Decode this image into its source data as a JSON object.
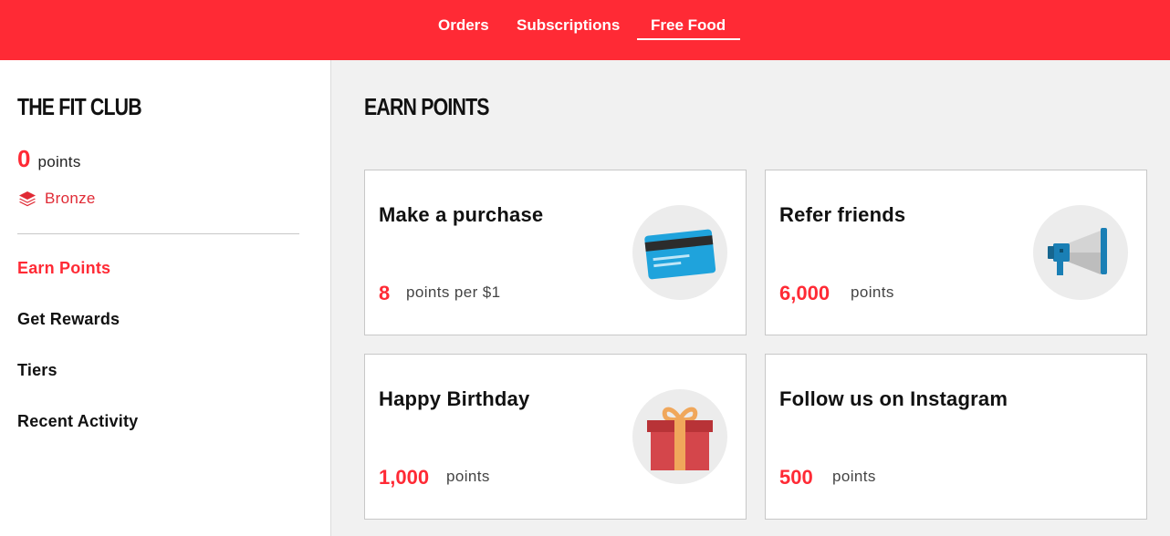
{
  "topnav": {
    "tabs": [
      {
        "label": "Orders"
      },
      {
        "label": "Subscriptions"
      },
      {
        "label": "Free Food",
        "active": true
      }
    ]
  },
  "sidebar": {
    "title": "THE FIT CLUB",
    "points_value": "0",
    "points_label": "points",
    "tier": "Bronze",
    "tier_icon": "layers-icon",
    "items": [
      {
        "label": "Earn Points",
        "active": true
      },
      {
        "label": "Get Rewards"
      },
      {
        "label": "Tiers"
      },
      {
        "label": "Recent Activity"
      }
    ]
  },
  "main": {
    "title": "EARN POINTS",
    "cards": [
      {
        "title": "Make a purchase",
        "value": "8",
        "unit": "points per $1",
        "icon": "credit-card-icon"
      },
      {
        "title": "Refer friends",
        "value": "6,000",
        "unit": "points",
        "icon": "megaphone-icon"
      },
      {
        "title": "Happy Birthday",
        "value": "1,000",
        "unit": "points",
        "icon": "gift-icon"
      },
      {
        "title": "Follow us on Instagram",
        "value": "500",
        "unit": "points"
      }
    ]
  },
  "colors": {
    "brand_red": "#ff2a35",
    "background": "#f1f1f1"
  }
}
